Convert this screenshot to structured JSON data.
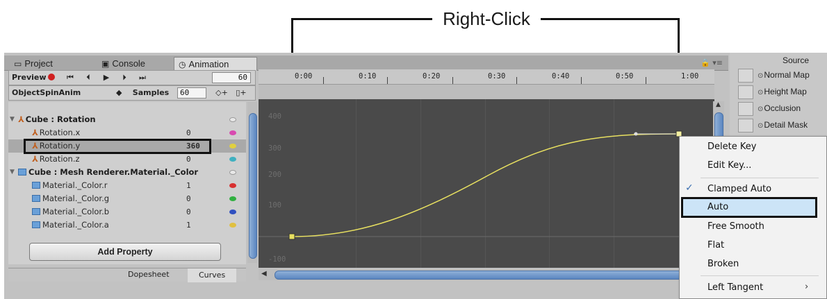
{
  "annotation": {
    "title": "Right-Click"
  },
  "tabs": [
    {
      "label": "Project",
      "icon": "folder-icon"
    },
    {
      "label": "Console",
      "icon": "console-icon"
    },
    {
      "label": "Animation",
      "icon": "clock-icon"
    }
  ],
  "toolbar": {
    "preview_label": "Preview",
    "frame_value": "60",
    "clip_name": "ObjectSpinAnim",
    "samples_label": "Samples",
    "samples_value": "60"
  },
  "properties": [
    {
      "name": "Cube : Rotation",
      "value": "",
      "color": "#a0a0a0"
    },
    {
      "name": "Rotation.x",
      "value": "0",
      "color": "#d84ab0"
    },
    {
      "name": "Rotation.y",
      "value": "360",
      "color": "#e0d040"
    },
    {
      "name": "Rotation.z",
      "value": "0",
      "color": "#40b0c0"
    },
    {
      "name": "Cube : Mesh Renderer.Material._Color",
      "value": "",
      "color": "#a0a0a0"
    },
    {
      "name": "Material._Color.r",
      "value": "1",
      "color": "#d83030"
    },
    {
      "name": "Material._Color.g",
      "value": "0",
      "color": "#30b040"
    },
    {
      "name": "Material._Color.b",
      "value": "0",
      "color": "#3050c0"
    },
    {
      "name": "Material._Color.a",
      "value": "1",
      "color": "#e0c040"
    }
  ],
  "add_property_label": "Add Property",
  "bottom_tabs": {
    "dopesheet": "Dopesheet",
    "curves": "Curves"
  },
  "timeline_labels": [
    "0:00",
    "0:10",
    "0:20",
    "0:30",
    "0:40",
    "0:50",
    "1:00"
  ],
  "y_labels": [
    "400",
    "300",
    "200",
    "100",
    "-100"
  ],
  "curve": {
    "color": "#e8e060"
  },
  "inspector": {
    "title": "Source",
    "rows": [
      "Normal Map",
      "Height Map",
      "Occlusion",
      "Detail Mask"
    ]
  },
  "context_menu": {
    "items": [
      "Delete Key",
      "Edit Key...",
      "Clamped Auto",
      "Auto",
      "Free Smooth",
      "Flat",
      "Broken",
      "Left Tangent"
    ],
    "checked": "Clamped Auto",
    "highlighted": "Auto"
  }
}
